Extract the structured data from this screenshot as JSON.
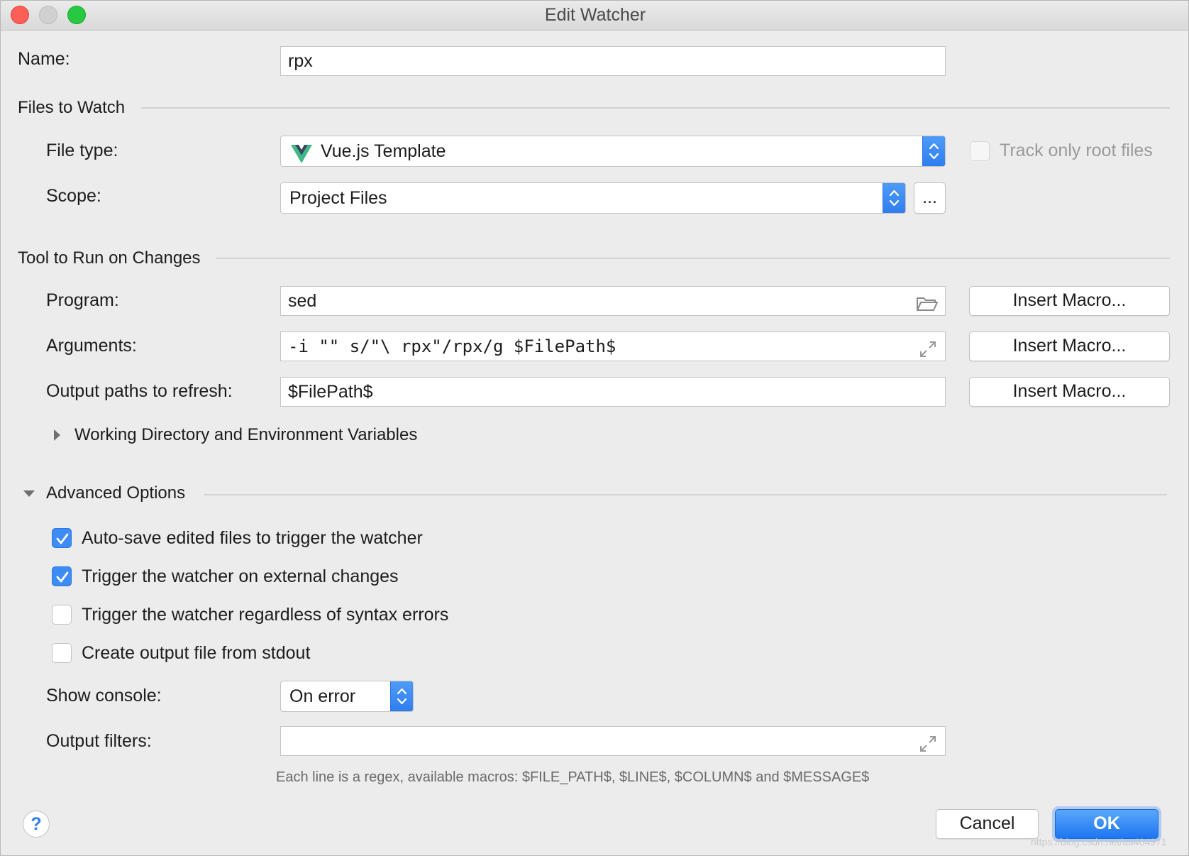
{
  "window": {
    "title": "Edit Watcher"
  },
  "name": {
    "label": "Name:",
    "value": "rpx"
  },
  "files_to_watch": {
    "title": "Files to Watch",
    "file_type": {
      "label": "File type:",
      "value": "Vue.js Template",
      "icon": "vue-logo-icon"
    },
    "track_root": {
      "label": "Track only root files",
      "checked": false,
      "enabled": false
    },
    "scope": {
      "label": "Scope:",
      "value": "Project Files",
      "browse_label": "..."
    }
  },
  "tool": {
    "title": "Tool to Run on Changes",
    "program": {
      "label": "Program:",
      "value": "sed",
      "icon": "folder-icon"
    },
    "arguments": {
      "label": "Arguments:",
      "value": "-i \"\" s/\"\\ rpx\"/rpx/g $FilePath$",
      "icon": "expand-icon"
    },
    "output_paths": {
      "label": "Output paths to refresh:",
      "value": "$FilePath$"
    },
    "insert_macro_label": "Insert Macro...",
    "working_dir": {
      "label": "Working Directory and Environment Variables",
      "expanded": false
    }
  },
  "advanced": {
    "title": "Advanced Options",
    "expanded": true,
    "options": [
      {
        "label": "Auto-save edited files to trigger the watcher",
        "checked": true
      },
      {
        "label": "Trigger the watcher on external changes",
        "checked": true
      },
      {
        "label": "Trigger the watcher regardless of syntax errors",
        "checked": false
      },
      {
        "label": "Create output file from stdout",
        "checked": false
      }
    ],
    "show_console": {
      "label": "Show console:",
      "value": "On error"
    },
    "output_filters": {
      "label": "Output filters:",
      "value": "",
      "hint": "Each line is a regex, available macros: $FILE_PATH$, $LINE$, $COLUMN$ and $MESSAGE$"
    }
  },
  "footer": {
    "help": "?",
    "cancel": "Cancel",
    "ok": "OK"
  },
  "watermark": "https://blog.csdn.net/aa464971",
  "colors": {
    "accent": "#3d8bf5",
    "close": "#fd5f57",
    "zoom": "#28c840"
  }
}
